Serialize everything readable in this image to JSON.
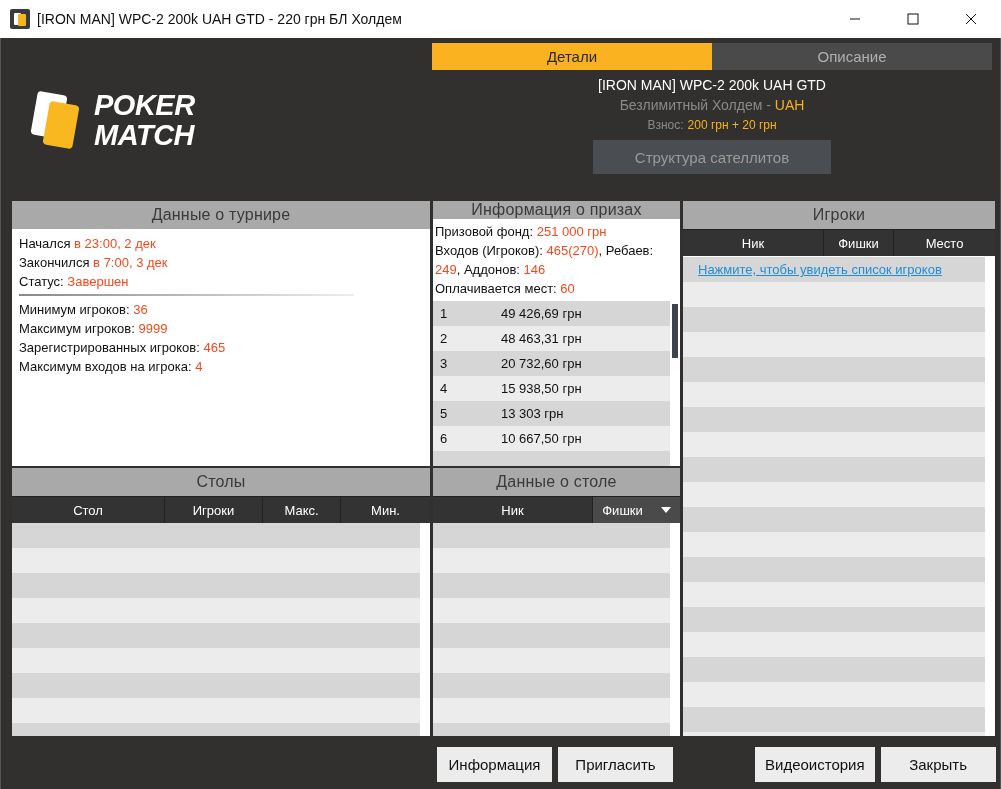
{
  "window": {
    "title": "[IRON MAN] WPC-2 200k UAH GTD - 220 грн БЛ Холдем"
  },
  "logo": {
    "line_1": "POKER",
    "line_2": "MATCH"
  },
  "tabs": [
    {
      "label": "Детали",
      "selected": true
    },
    {
      "label": "Описание",
      "selected": false
    }
  ],
  "summary": {
    "name": "[IRON MAN] WPC-2 200k UAH GTD",
    "game": "Безлимитный Холдем - ",
    "currency": "UAH",
    "buyin_label": "Взнос:",
    "buyin": "200 грн + 20 грн",
    "satellites_button": "Структура сателлитов"
  },
  "tournament": {
    "title": "Данные о турнире",
    "groups": [
      [
        {
          "label": "Начался ",
          "value": "в 23:00, 2 дек"
        },
        {
          "label": "Закончился ",
          "value": "в 7:00, 3 дек"
        },
        {
          "label": "Статус: ",
          "value": "Завершен"
        }
      ],
      [
        {
          "label": "Минимум игроков: ",
          "value": "36"
        },
        {
          "label": "Максимум игроков: ",
          "value": "9999"
        },
        {
          "label": "Зарегистрированных игроков: ",
          "value": "465"
        },
        {
          "label": "Максимум входов на игрока: ",
          "value": "4"
        }
      ]
    ]
  },
  "prizes": {
    "title": "Информация о призах",
    "paragraphs": [
      [
        {
          "text": "Призовой фонд: ",
          "highlight": false
        },
        {
          "text": "251 000 грн",
          "highlight": true
        }
      ],
      [
        {
          "text": "Входов (Игроков): ",
          "highlight": false
        },
        {
          "text": "465(270)",
          "highlight": true
        },
        {
          "text": ", Ребаев: ",
          "highlight": false
        },
        {
          "text": "249",
          "highlight": true
        },
        {
          "text": ", Аддонов: ",
          "highlight": false
        },
        {
          "text": "146",
          "highlight": true
        }
      ],
      [
        {
          "text": "Оплачивается мест: ",
          "highlight": false
        },
        {
          "text": "60",
          "highlight": true
        }
      ]
    ],
    "rows": [
      {
        "place": "1",
        "amount": "49 426,69 грн"
      },
      {
        "place": "2",
        "amount": "48 463,31 грн"
      },
      {
        "place": "3",
        "amount": "20 732,60 грн"
      },
      {
        "place": "4",
        "amount": "15 938,50 грн"
      },
      {
        "place": "5",
        "amount": "13 303 грн"
      },
      {
        "place": "6",
        "amount": "10 667,50 грн"
      }
    ]
  },
  "players": {
    "title": "Игроки",
    "columns": [
      {
        "label": "Ник",
        "sorted": false
      },
      {
        "label": "Фишки",
        "sorted": false
      },
      {
        "label": "Место",
        "sorted": false
      }
    ],
    "link": "Нажмите, чтобы увидеть список игроков"
  },
  "tables": {
    "title": "Столы",
    "columns": [
      {
        "label": "Стол",
        "sorted": false
      },
      {
        "label": "Игроки",
        "sorted": false
      },
      {
        "label": "Макс.",
        "sorted": false
      },
      {
        "label": "Мин.",
        "sorted": false
      }
    ]
  },
  "table_details": {
    "title": "Данные о столе",
    "columns": [
      {
        "label": "Ник",
        "sorted": false
      },
      {
        "label": "Фишки",
        "sorted": true
      }
    ]
  },
  "buttons_left": [
    "Информация",
    "Пригласить"
  ],
  "buttons_right": [
    "Видеоистория",
    "Закрыть"
  ]
}
